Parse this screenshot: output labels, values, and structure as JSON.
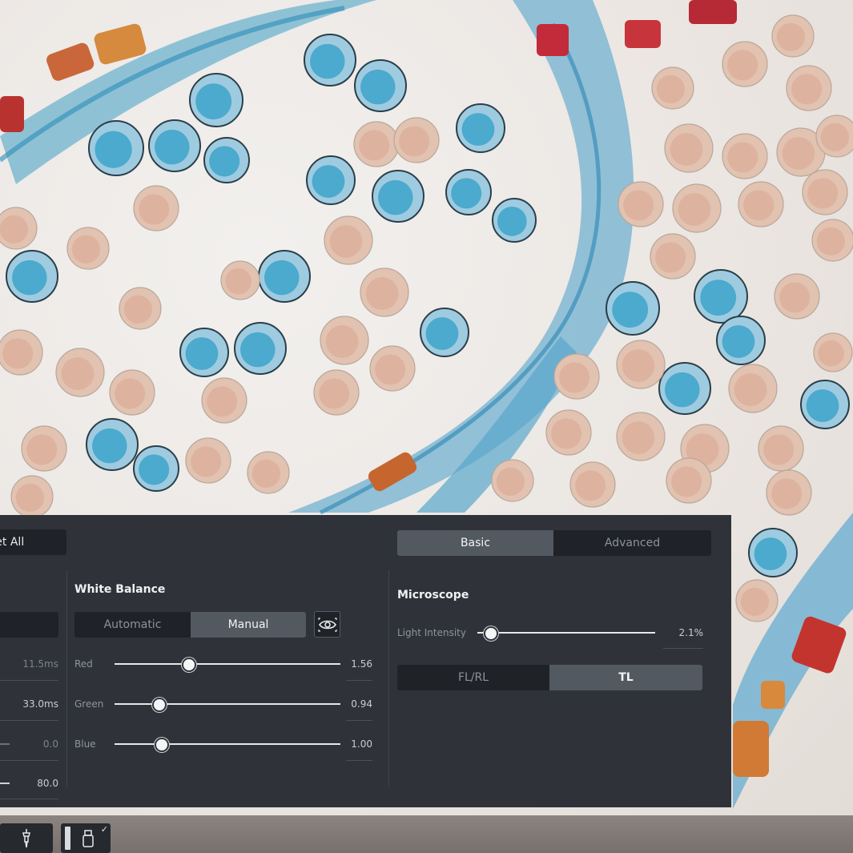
{
  "toolbar_top": {
    "reset_label": "set All"
  },
  "mode_tabs": {
    "basic": "Basic",
    "advanced": "Advanced",
    "active": "Basic"
  },
  "exposure": {
    "value_1": "11.5ms",
    "value_2": "33.0ms",
    "value_3": "0.0",
    "value_4": "80.0"
  },
  "white_balance": {
    "title": "White Balance",
    "mode_automatic": "Automatic",
    "mode_manual": "Manual",
    "active_mode": "Manual",
    "channels": [
      {
        "label": "Red",
        "value": "1.56",
        "level": 0.33
      },
      {
        "label": "Green",
        "value": "0.94",
        "level": 0.2
      },
      {
        "label": "Blue",
        "value": "1.00",
        "level": 0.21
      }
    ],
    "preview_icon": "eye-icon"
  },
  "microscope": {
    "title": "Microscope",
    "light_label": "Light Intensity",
    "light_value": "2.1%",
    "light_level": 0.021,
    "illumination_fl": "FL/RL",
    "illumination_tl": "TL",
    "active_illumination": "TL"
  },
  "bottom_tools": {
    "tool_1_icon": "pipette-icon",
    "tool_2_icon": "usb-drive-icon",
    "tool_2_check": "✓"
  },
  "colors": {
    "panel_bg": "#2f3339",
    "segment_active": "#535960",
    "segment_bg": "#1f2227"
  }
}
